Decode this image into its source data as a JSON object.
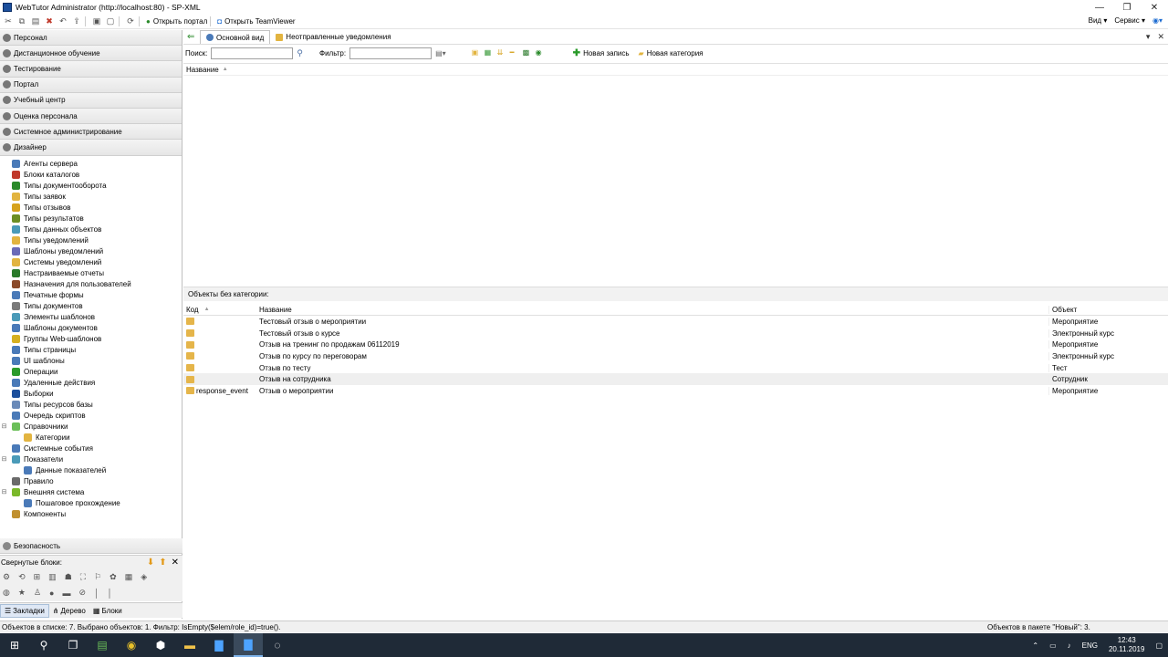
{
  "window": {
    "title": "WebTutor Administrator (http://localhost:80) - SP-XML"
  },
  "toolbar": {
    "open_portal": "Открыть портал",
    "open_teamviewer": "Открыть TeamViewer",
    "view": "Вид",
    "service": "Сервис"
  },
  "sidebar": {
    "sections": [
      "Персонал",
      "Дистанционное обучение",
      "Тестирование",
      "Портал",
      "Учебный центр",
      "Оценка персонала",
      "Системное администрирование",
      "Дизайнер"
    ],
    "tree": [
      "Агенты сервера",
      "Блоки каталогов",
      "Типы документооборота",
      "Типы заявок",
      "Типы отзывов",
      "Типы результатов",
      "Типы данных объектов",
      "Типы уведомлений",
      "Шаблоны уведомлений",
      "Системы уведомлений",
      "Настраиваемые отчеты",
      "Назначения для пользователей",
      "Печатные формы",
      "Типы документов",
      "Элементы шаблонов",
      "Шаблоны документов",
      "Группы Web-шаблонов",
      "Типы страницы",
      "UI шаблоны",
      "Операции",
      "Удаленные действия",
      "Выборки",
      "Типы ресурсов базы",
      "Очередь скриптов",
      "Справочники",
      "Категории",
      "Системные события",
      "Показатели",
      "Данные показателей",
      "Правило",
      "Внешняя система",
      "Пошаговое прохождение",
      "Компоненты"
    ],
    "security": "Безопасность",
    "collapsed_blocks": "Свернутые блоки:",
    "nav_tabs": {
      "bookmarks": "Закладки",
      "tree": "Дерево",
      "blocks": "Блоки"
    }
  },
  "main": {
    "tabs": {
      "main_view": "Основной вид",
      "unsent": "Неотправленные уведомления"
    },
    "search_label": "Поиск:",
    "filter_label": "Фильтр:",
    "new_record": "Новая запись",
    "new_category": "Новая категория",
    "upper_col_name": "Название",
    "category_caption": "Объекты без категории:",
    "table": {
      "headers": {
        "code": "Код",
        "name": "Название",
        "object": "Объект"
      },
      "rows": [
        {
          "code": "",
          "name": "Тестовый отзыв о мероприятии",
          "object": "Мероприятие"
        },
        {
          "code": "",
          "name": "Тестовый отзыв о курсе",
          "object": "Электронный курс"
        },
        {
          "code": "",
          "name": "Отзыв на тренинг по продажам 06112019",
          "object": "Мероприятие"
        },
        {
          "code": "",
          "name": "Отзыв по курсу по переговорам",
          "object": "Электронный курс"
        },
        {
          "code": "",
          "name": "Отзыв по тесту",
          "object": "Тест"
        },
        {
          "code": "",
          "name": "Отзыв на сотрудника",
          "object": "Сотрудник"
        },
        {
          "code": "response_event",
          "name": "Отзыв о мероприятии",
          "object": "Мероприятие"
        }
      ]
    }
  },
  "status": {
    "left": "Объектов в списке: 7. Выбрано объектов: 1. Фильтр: IsEmpty($elem/role_id)=true().",
    "right": "Объектов в пакете \"Новый\": 3."
  },
  "taskbar": {
    "lang": "ENG",
    "time": "12:43",
    "date": "20.11.2019"
  }
}
